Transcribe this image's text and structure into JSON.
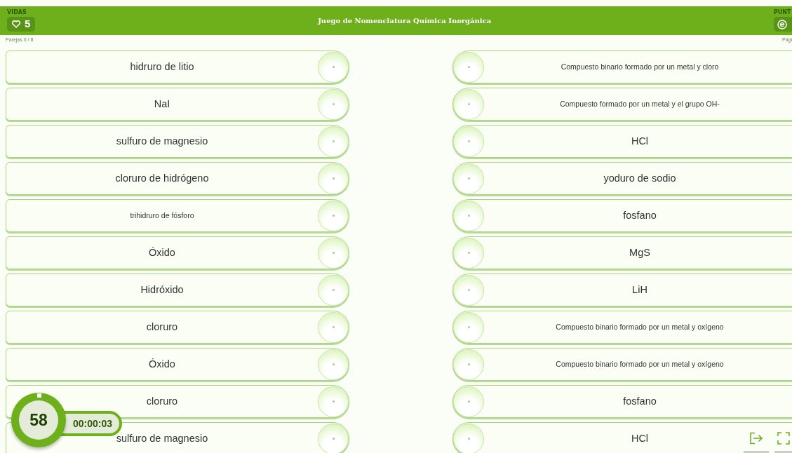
{
  "header": {
    "lives_label": "VIDAS",
    "lives": "5",
    "title": "Juego de Nomenclatura Química Inorgánica",
    "points_label": "PUNT"
  },
  "progress": {
    "pairs": "Parejas 0 / 8",
    "page": "Pági"
  },
  "left_cards": [
    {
      "text": "hidruro de litio",
      "kind": "regular"
    },
    {
      "text": "NaI",
      "kind": "regular"
    },
    {
      "text": "sulfuro de magnesio",
      "kind": "regular"
    },
    {
      "text": "cloruro de hidrógeno",
      "kind": "regular"
    },
    {
      "text": "trihidruro de fósforo",
      "kind": "compact"
    },
    {
      "text": "Óxido",
      "kind": "regular"
    },
    {
      "text": "Hidróxido",
      "kind": "regular"
    },
    {
      "text": "cloruro",
      "kind": "regular"
    },
    {
      "text": "Óxido",
      "kind": "regular"
    },
    {
      "text": "cloruro",
      "kind": "regular"
    },
    {
      "text": "sulfuro de magnesio",
      "kind": "regular"
    }
  ],
  "right_cards": [
    {
      "text": "Compuesto binario formado por un metal y cloro",
      "kind": "compact"
    },
    {
      "text": "Compuesto formado por un metal y el grupo OH-",
      "kind": "compact"
    },
    {
      "text": "HCl",
      "kind": "regular"
    },
    {
      "text": "yoduro de sodio",
      "kind": "regular"
    },
    {
      "text": "fosfano",
      "kind": "regular"
    },
    {
      "text": "MgS",
      "kind": "regular"
    },
    {
      "text": "LiH",
      "kind": "regular"
    },
    {
      "text": "Compuesto binario formado por un metal y oxígeno",
      "kind": "compact"
    },
    {
      "text": "Compuesto binario formado por un metal y oxígeno",
      "kind": "compact"
    },
    {
      "text": "fosfano",
      "kind": "regular"
    },
    {
      "text": "HCl",
      "kind": "regular"
    }
  ],
  "timer": {
    "countdown": "58",
    "elapsed": "00:00:03"
  }
}
